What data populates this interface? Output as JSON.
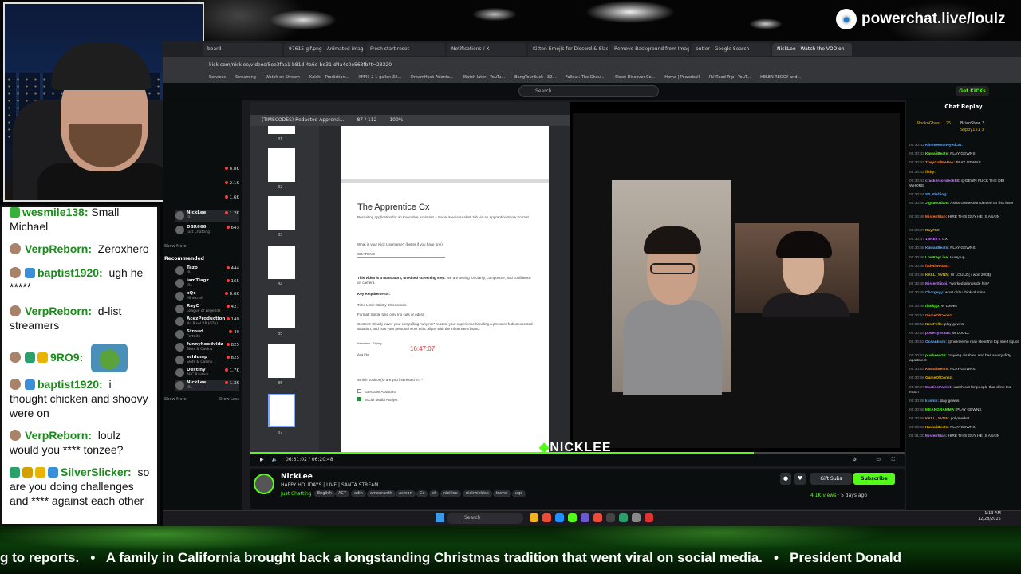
{
  "brand": {
    "name": "powerchat.live/loulz"
  },
  "overlay_chat": [
    {
      "user": "wesmile138:",
      "text": "Small Michael",
      "cut": true
    },
    {
      "user": "VerpReborn:",
      "text": "Zeroxhero"
    },
    {
      "user": "baptist1920:",
      "text": "ugh he *****"
    },
    {
      "user": "VerpReborn:",
      "text": "d-list streamers"
    },
    {
      "user": "9RO9:",
      "text": ""
    },
    {
      "user": "baptist1920:",
      "text": "i thought chicken and shoovy were on"
    },
    {
      "user": "VerpReborn:",
      "text": "loulz would you **** tonzee?"
    },
    {
      "user": "SilverSlicker:",
      "text": "so are you doing challenges and **** against each other"
    }
  ],
  "browser": {
    "tabs": [
      "board",
      "97615-gif.png - Animated image",
      "Fresh start reset",
      "Notifications / X",
      "Kitten Emojis for Discord & Slack",
      "Remove Background from Image",
      "butler - Google Search",
      "NickLee - Watch the VOD on"
    ],
    "active_tab": 7,
    "url": "kick.com/nicklee/videos/5ee3faa1-b81d-4a6d-bd31-d4a4c0e563fb?t=23320",
    "bookmarks": [
      "Services",
      "Streaming",
      "Watch on Stream",
      "Kalshi - Prediction...",
      "XM43-2 1-gallon 32...",
      "DreamHack Atlanta...",
      "Watch later - YouTu...",
      "BangYourBuck - 32...",
      "Fallout: The Ghoul...",
      "Skoot Discover Co...",
      "Home | Powerball",
      "RV Road Trip - YouT...",
      "HELEN REGGY and..."
    ]
  },
  "kick": {
    "search_placeholder": "Search",
    "get_kicks": "Get KICKs",
    "sidebar": [
      {
        "name": "",
        "game": "",
        "viewers": "8.8K"
      },
      {
        "name": "",
        "game": "",
        "viewers": "2.1K"
      },
      {
        "name": "",
        "game": "",
        "viewers": "1.6K"
      },
      {
        "name": "NickLee",
        "game": "IRL",
        "viewers": "1.2K"
      },
      {
        "name": "DBR666",
        "game": "Just Chatting",
        "viewers": "643"
      }
    ],
    "show_more": "Show More",
    "recommended": "Recommended",
    "recommended_list": [
      {
        "name": "Tazo",
        "game": "IRL",
        "viewers": "444"
      },
      {
        "name": "iamTiagz",
        "game": "IRL",
        "viewers": "165"
      },
      {
        "name": "xQc",
        "game": "Minecraft",
        "viewers": "8.6K"
      },
      {
        "name": "RayC",
        "game": "League of Legends",
        "viewers": "427"
      },
      {
        "name": "AcezProduction",
        "game": "No Pixel RP (GTA)",
        "viewers": "140"
      },
      {
        "name": "Stroud",
        "game": "Fortnite",
        "viewers": "49"
      },
      {
        "name": "funnyhoodvidz",
        "game": "Slots & Casino",
        "viewers": "825"
      },
      {
        "name": "schlump",
        "game": "Slots & Casino",
        "viewers": "825"
      },
      {
        "name": "Destiny",
        "game": "ARC Raiders",
        "viewers": "1.7K"
      },
      {
        "name": "NickLee",
        "game": "IRL",
        "viewers": "1.3K"
      }
    ],
    "show_less": "Show Less",
    "channel": {
      "name": "NickLee",
      "title": "HAPPY HOLIDAYS | LIVE | SANTA STREAM",
      "category": "Just Chatting",
      "tags": [
        "English",
        "AC7",
        "adin",
        "amouranth",
        "asmon",
        "Cx",
        "el",
        "nicklee",
        "nickwicklee",
        "travel",
        "xqc"
      ],
      "views": "4.1K views",
      "age": "5 days ago",
      "gift_subs": "Gift Subs",
      "subscribe": "Subscribe"
    },
    "overlay_logo": "NICKLEE",
    "vod_time": "06:31:02 / 06:20:48",
    "progress_frac": 0.77
  },
  "pdf": {
    "title": "(TIMECODES) Redacted Apprenti...",
    "page": "87",
    "total": "/ 112",
    "zoom": "100%",
    "thumb_pages": [
      "81",
      "82",
      "83",
      "84",
      "85",
      "86",
      "87"
    ],
    "heading": "The Apprentice Cx",
    "subtitle": "Recruiting application for an Executive Assistant + Social Media Analyst Job via an Apprentice Show Format",
    "q_username": "What is your Kick Username? (better if you have one)",
    "username_answer": "CRATONG",
    "mandatory": "This video is a mandatory, unedited screening step.",
    "mandatory_rest": "We are testing for clarity, composure, and confidence on camera.",
    "key_req": "Key Requirements:",
    "time_limit": "Time Limit: Strictly 60 seconds.",
    "format": "Format: Single take only (no cuts or edits).",
    "content": "Content: Clearly cover your compelling \"why me\" reason, your experience handling a pressure fed/unexpected situation, and how your personal work ethic aligns with the influencer's brand.",
    "file_label": "Interview - Trying",
    "add_file": "Add File",
    "timer": "16:47:07",
    "q_position": "Which position(s) are you interested in? *",
    "opt1": "Executive Assistant",
    "opt2": "Social Media Analyst"
  },
  "replay": {
    "title": "Chat Replay",
    "top": [
      {
        "name": "RockoGhost...",
        "n": "25"
      },
      {
        "name": "BrianStow",
        "n": "3"
      },
      {
        "name": "Slippy151",
        "n": "3"
      }
    ],
    "messages": [
      {
        "t": "06:30:42",
        "u": "Kimmeesoneyedcat:",
        "m": ""
      },
      {
        "t": "06:30:42",
        "u": "KawaiiBeats:",
        "m": "PLAY GEWNS"
      },
      {
        "t": "06:30:42",
        "u": "TheyCallMeRex:",
        "m": "PLAY GEWNS"
      },
      {
        "t": "06:30:42",
        "u": "fishy:",
        "m": ""
      },
      {
        "t": "06:30:43",
        "u": "crackersondeck88:",
        "m": "@GEWN FUCK THE DEI WHORE"
      },
      {
        "t": "06:30:44",
        "u": "SS_Fishing:",
        "m": ""
      },
      {
        "t": "06:30:45",
        "u": "Jigsaw3dam:",
        "m": "Asian connection denied on this loser"
      },
      {
        "t": "06:30:46",
        "u": "MisterrMan:",
        "m": "HIRE THIS GUY HE IS ASAIN"
      },
      {
        "t": "06:30:47",
        "u": "Ray703:",
        "m": ""
      },
      {
        "t": "06:30:47",
        "u": "1BRETT:",
        "m": "CX"
      },
      {
        "t": "06:30:48",
        "u": "KawaiiBeats:",
        "m": "PLAY GEWNS"
      },
      {
        "t": "06:30:48",
        "u": "LowKeyLive:",
        "m": "Hurry up"
      },
      {
        "t": "06:30:48",
        "u": "fadedwcoast:",
        "m": ""
      },
      {
        "t": "06:30:48",
        "u": "KKLL_YVNN:",
        "m": "W LOULZ ( i won 200$)"
      },
      {
        "t": "06:30:49",
        "u": "MisterSlippi:",
        "m": "*worked alongside him*"
      },
      {
        "t": "06:30:49",
        "u": "Chargeyy:",
        "m": "what did u think of mine"
      },
      {
        "t": "06:30:49",
        "u": "dankpp:",
        "m": "W Lowes"
      },
      {
        "t": "06:30:51",
        "u": "GameOfConez:",
        "m": ""
      },
      {
        "t": "06:30:52",
        "u": "NewFello:",
        "m": "play gewns"
      },
      {
        "t": "06:30:52",
        "u": "povertyssaus:",
        "m": "W LOULZ"
      },
      {
        "t": "06:30:53",
        "u": "Oceanburn:",
        "m": "@nicklee he may steal the top shelf liquor"
      },
      {
        "t": "06:30:53",
        "u": "pusheen10:",
        "m": "crayong disabled and has a very dirty apartment"
      },
      {
        "t": "06:30:53",
        "u": "KawaiiBeats:",
        "m": "PLAY GEWNS"
      },
      {
        "t": "06:30:56",
        "u": "GameOfConez:",
        "m": ""
      },
      {
        "t": "06:30:57",
        "u": "MartinsPatriot:",
        "m": "watch out for people that drink too much"
      },
      {
        "t": "06:30:58",
        "u": "kushin:",
        "m": "play gewns"
      },
      {
        "t": "06:30:58",
        "u": "MEANGRAMMA:",
        "m": "PLAY GEWNS"
      },
      {
        "t": "06:30:58",
        "u": "KKLL_YVNN:",
        "m": "polymarket"
      },
      {
        "t": "06:30:58",
        "u": "KawaiiBeats:",
        "m": "PLAY GEWNS"
      },
      {
        "t": "06:31:00",
        "u": "MisterrMan:",
        "m": "HIRE THIS GUY HE IS ASAIN"
      }
    ]
  },
  "taskbar": {
    "search": "Search",
    "time": "1:13 AM",
    "date": "12/28/2025"
  },
  "ticker": {
    "text": "g to reports.   •   A family in California brought back a longstanding Christmas tradition that went viral on social media.   •   President Donald"
  },
  "colors": {
    "kick_green": "#53fc18",
    "chat_user_green": "#1d8a1d",
    "ticker_bg": "#0a3a0a"
  }
}
